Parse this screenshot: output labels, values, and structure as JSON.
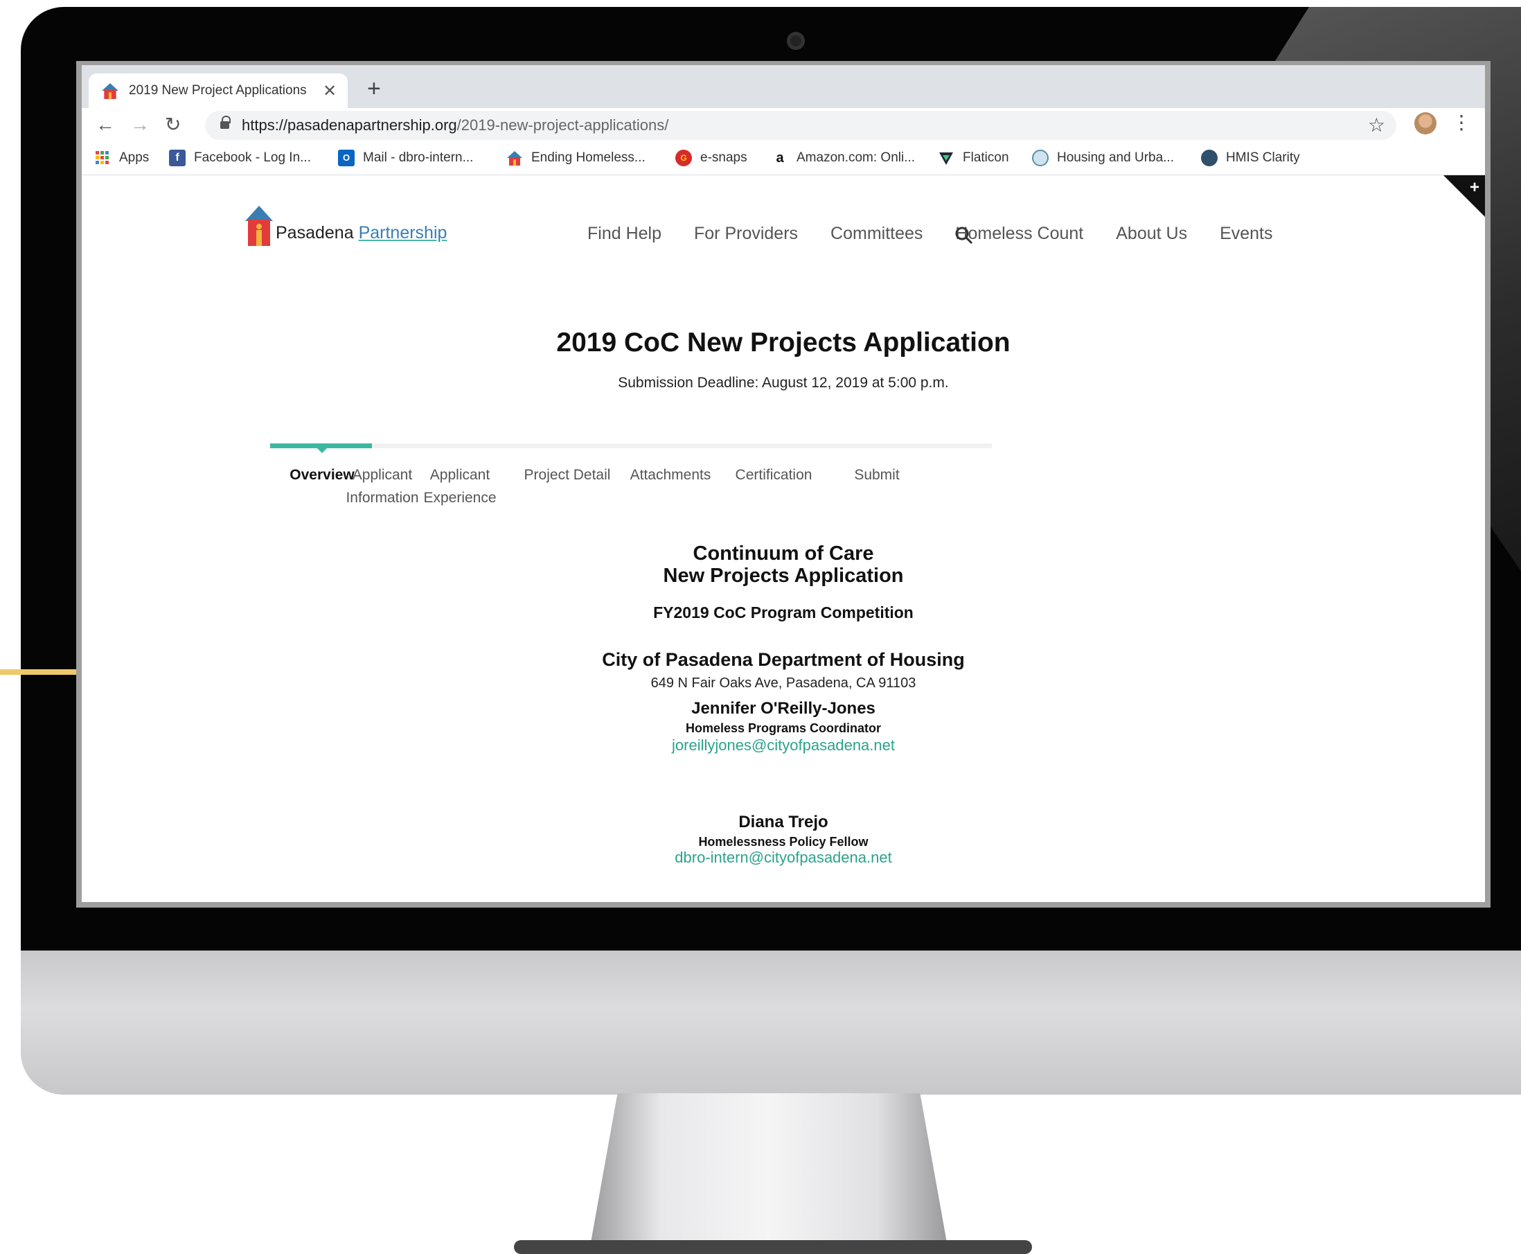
{
  "browser": {
    "tab_title": "2019 New Project Applications",
    "url_host": "https://pasadenapartnership.org",
    "url_path": "/2019-new-project-applications/",
    "bookmarks": [
      {
        "label": "Apps",
        "icon": "apps-grid-icon"
      },
      {
        "label": "Facebook - Log In...",
        "icon": "facebook-icon"
      },
      {
        "label": "Mail - dbro-intern...",
        "icon": "outlook-icon"
      },
      {
        "label": "Ending Homeless...",
        "icon": "house-icon"
      },
      {
        "label": "e-snaps",
        "icon": "esnaps-icon"
      },
      {
        "label": "Amazon.com: Onli...",
        "icon": "amazon-icon"
      },
      {
        "label": "Flaticon",
        "icon": "flaticon-icon"
      },
      {
        "label": "Housing and Urba...",
        "icon": "hud-seal-icon"
      },
      {
        "label": "HMIS Clarity",
        "icon": "hmis-icon"
      }
    ]
  },
  "site": {
    "logo_part1": "Pasadena",
    "logo_part2": "Partnership",
    "nav": [
      "Find Help",
      "For Providers",
      "Committees",
      "Homeless Count",
      "About Us",
      "Events"
    ]
  },
  "content": {
    "title": "2019 CoC New Projects Application",
    "deadline": "Submission Deadline: August 12, 2019 at 5:00 p.m.",
    "steps": [
      {
        "label": "Overview",
        "active": true
      },
      {
        "label": "Applicant Information",
        "active": false
      },
      {
        "label": "Applicant Experience",
        "active": false
      },
      {
        "label": "Project Detail",
        "active": false
      },
      {
        "label": "Attachments",
        "active": false
      },
      {
        "label": "Certification",
        "active": false
      },
      {
        "label": "Submit",
        "active": false
      }
    ],
    "heading1": "Continuum of Care",
    "heading2": "New Projects Application",
    "competition": "FY2019 CoC Program Competition",
    "department": "City of Pasadena Department of Housing",
    "address": "649 N Fair Oaks Ave, Pasadena, CA 91103",
    "contact1": {
      "name": "Jennifer O'Reilly-Jones",
      "role": "Homeless Programs Coordinator",
      "email": "joreillyjones@cityofpasadena.net"
    },
    "contact2": {
      "name": "Diana Trejo",
      "role": "Homelessness Policy Fellow",
      "email": "dbro-intern@cityofpasadena.net"
    }
  },
  "colors": {
    "accent": "#3cb8a0",
    "link": "#2ba28d",
    "highlight": "#ecc96a"
  }
}
